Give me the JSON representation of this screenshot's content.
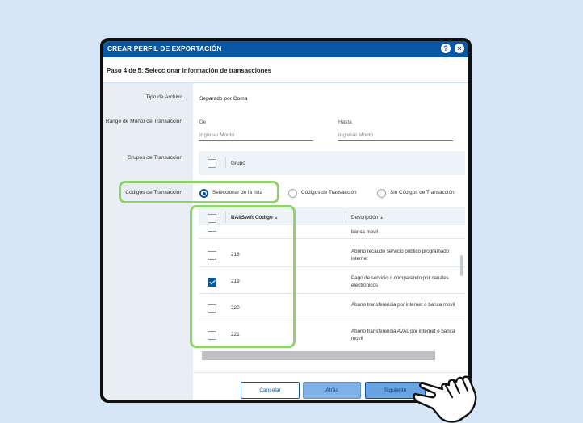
{
  "dialog": {
    "title": "CREAR PERFIL DE EXPORTACIÓN",
    "help_icon": "?",
    "close_icon": "×",
    "step": "Paso 4 de 5: Seleccionar información de transacciones"
  },
  "form": {
    "file_type_label": "Tipo de Archivo",
    "file_type_value": "Separado por Coma",
    "amount_range_label": "Rango de Monto de Transacción",
    "from_label": "De",
    "from_placeholder": "Ingresar Monto",
    "to_label": "Hasta",
    "to_placeholder": "Ingresar Monto",
    "groups_label": "Grupos de Transacción",
    "group_column": "Grupo",
    "codes_label": "Códigos de Transacción",
    "radio_options": [
      {
        "label": "Seleccionar de la lista",
        "selected": true
      },
      {
        "label": "Códigos de Transacción",
        "selected": false
      },
      {
        "label": "Sin Códigos de Transacción",
        "selected": false
      }
    ]
  },
  "table": {
    "col_code": "BAI/Swift Código",
    "col_desc": "Descripción",
    "sort_icon": "▲",
    "partial_row_desc": "banca movil",
    "rows": [
      {
        "code": "218",
        "desc": "Abono recaudo servicio publico programado internet",
        "checked": false
      },
      {
        "code": "219",
        "desc": "Pago de servicio o comparendo por canales electronicos",
        "checked": true
      },
      {
        "code": "220",
        "desc": "Abono transferencia por internet o banca movil",
        "checked": false
      },
      {
        "code": "221",
        "desc": "Abono transferencia AVAL por internet o banca movil",
        "checked": false
      }
    ]
  },
  "footer": {
    "cancel": "Cancelar",
    "back": "Atrás",
    "next": "Siguiente"
  },
  "colors": {
    "header_blue": "#0b56a3",
    "highlight_green": "#8ed36b",
    "background": "#d6e6f6"
  }
}
